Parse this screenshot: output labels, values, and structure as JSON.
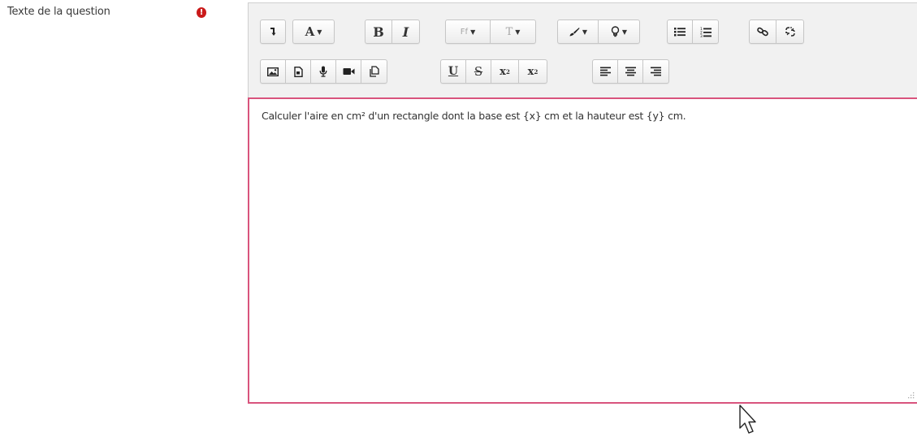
{
  "field": {
    "label": "Texte de la question",
    "required_icon": "exclamation-circle-icon",
    "required_color": "#ca1a1a"
  },
  "toolbar": {
    "row1": [
      {
        "name": "collapse-button",
        "icon": "arrow-down-toggle-icon"
      },
      {
        "name": "style-menu-button",
        "icon": "font-style-icon",
        "label": "A",
        "dropdown": true
      },
      {
        "name": "bold-button",
        "label": "B"
      },
      {
        "name": "italic-button",
        "label": "I"
      },
      {
        "name": "font-family-button",
        "icon": "font-family-icon",
        "label": "Ff",
        "dropdown": true,
        "disabled": true
      },
      {
        "name": "font-size-button",
        "icon": "font-size-icon",
        "label": "T",
        "dropdown": true,
        "disabled": true
      },
      {
        "name": "font-color-button",
        "icon": "brush-icon",
        "dropdown": true
      },
      {
        "name": "background-color-button",
        "icon": "bulb-icon",
        "dropdown": true
      },
      {
        "name": "unordered-list-button",
        "icon": "bullet-list-icon"
      },
      {
        "name": "ordered-list-button",
        "icon": "numbered-list-icon"
      },
      {
        "name": "link-button",
        "icon": "link-icon"
      },
      {
        "name": "unlink-button",
        "icon": "unlink-icon"
      }
    ],
    "row2": [
      {
        "name": "image-button",
        "icon": "image-icon"
      },
      {
        "name": "media-button",
        "icon": "file-media-icon"
      },
      {
        "name": "record-audio-button",
        "icon": "microphone-icon"
      },
      {
        "name": "record-video-button",
        "icon": "video-camera-icon"
      },
      {
        "name": "manage-files-button",
        "icon": "files-icon"
      },
      {
        "name": "underline-button",
        "label": "U"
      },
      {
        "name": "strikethrough-button",
        "label": "S"
      },
      {
        "name": "subscript-button",
        "label": "x",
        "sub": "2"
      },
      {
        "name": "superscript-button",
        "label": "x",
        "sup": "2"
      },
      {
        "name": "align-left-button",
        "icon": "align-left-icon"
      },
      {
        "name": "align-center-button",
        "icon": "align-center-icon"
      },
      {
        "name": "align-right-button",
        "icon": "align-right-icon"
      }
    ]
  },
  "editor": {
    "content": "Calculer l'aire en cm² d'un rectangle dont la base est {x} cm et la hauteur est {y} cm.",
    "border_color": "#d9547d"
  },
  "cursor": {
    "icon": "mouse-pointer-icon"
  }
}
